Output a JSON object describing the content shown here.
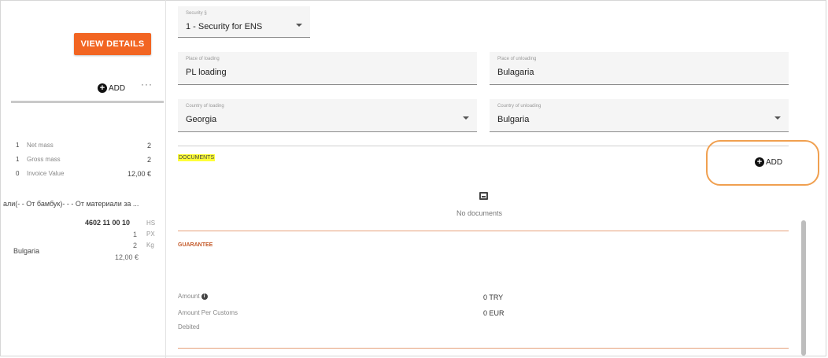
{
  "left": {
    "view_details_label": "VIEW DETAILS",
    "add_label": "ADD",
    "more_label": "···",
    "summary": [
      {
        "qty": "1",
        "label": "Net mass",
        "value": "2"
      },
      {
        "qty": "1",
        "label": "Gross mass",
        "value": "2"
      },
      {
        "qty": "0",
        "label": "Invoice Value",
        "value": "12,00 €"
      }
    ],
    "item_description": "али(- - От бамбук)- - - От материали за ...",
    "hs_code": "4602 11 00 10",
    "hs_label": "HS",
    "px_value": "1",
    "px_label": "PX",
    "kg_value": "2",
    "kg_label": "Kg",
    "country": "Bulgaria",
    "price": "12,00 €"
  },
  "form": {
    "security": {
      "label": "Security §",
      "value": "1 - Security for ENS"
    },
    "place_loading": {
      "label": "Place of loading",
      "value": "PL loading"
    },
    "place_unloading": {
      "label": "Place of unloading",
      "value": "Bulagaria"
    },
    "country_loading": {
      "label": "Country of loading",
      "value": "Georgia"
    },
    "country_unloading": {
      "label": "Country of unloading",
      "value": "Bulgaria"
    }
  },
  "documents": {
    "title": "DOCUMENTS",
    "add_label": "ADD",
    "empty_text": "No documents"
  },
  "guarantee": {
    "title": "GUARANTEE",
    "amount_label": "Amount",
    "amount_value": "0 TRY",
    "amount_per_customs_label": "Amount Per Customs",
    "amount_per_customs_value": "0 EUR",
    "debited_label": "Debited"
  },
  "colors": {
    "accent": "#f26522",
    "highlight": "#ffff38",
    "annotation": "#f0a050"
  }
}
